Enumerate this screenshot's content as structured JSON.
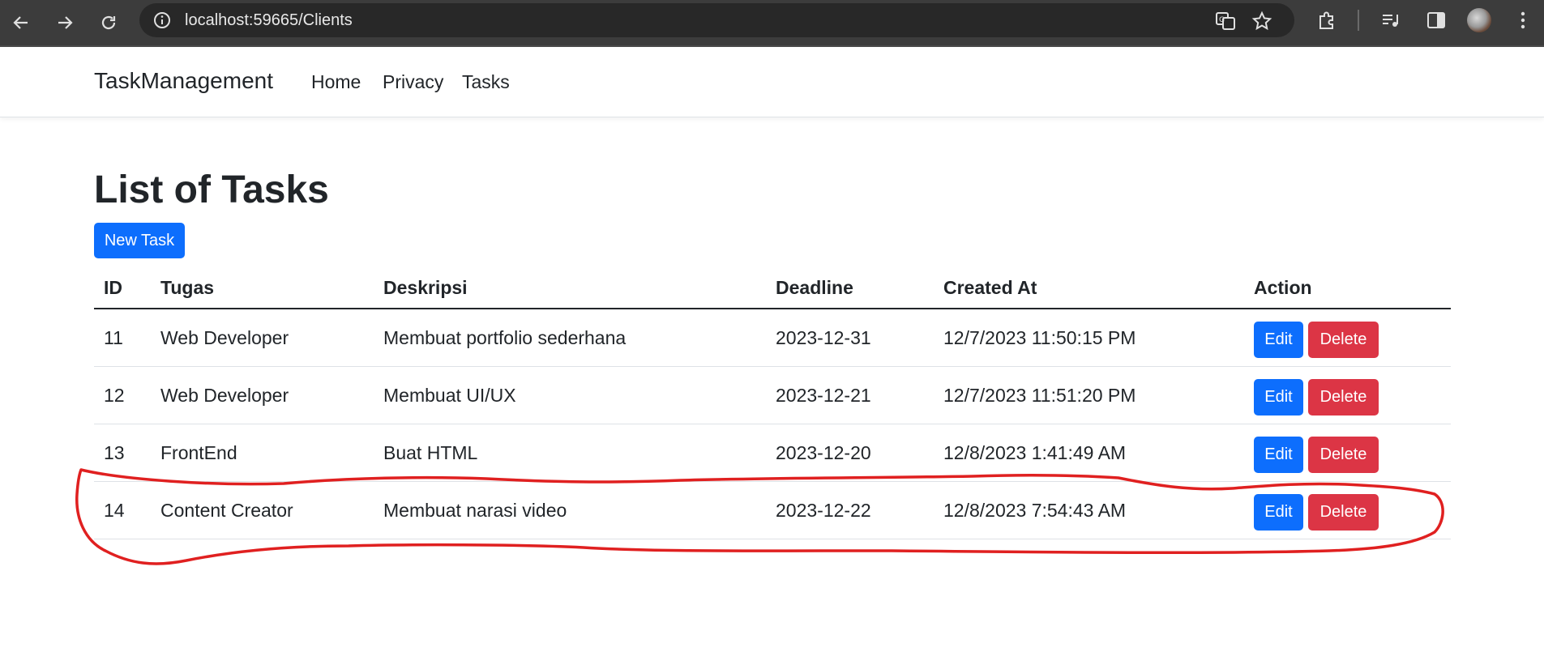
{
  "browser": {
    "url_host": "localhost:59665",
    "url_path": "/Clients"
  },
  "navbar": {
    "brand": "TaskManagement",
    "links": [
      "Home",
      "Privacy",
      "Tasks"
    ]
  },
  "main": {
    "title": "List of Tasks",
    "new_button": "New Task",
    "table": {
      "headers": [
        "ID",
        "Tugas",
        "Deskripsi",
        "Deadline",
        "Created At",
        "Action"
      ],
      "rows": [
        {
          "id": "11",
          "task": "Web Developer",
          "desc": "Membuat portfolio sederhana",
          "deadline": "2023-12-31",
          "created": "12/7/2023 11:50:15 PM"
        },
        {
          "id": "12",
          "task": "Web Developer",
          "desc": "Membuat UI/UX",
          "deadline": "2023-12-21",
          "created": "12/7/2023 11:51:20 PM"
        },
        {
          "id": "13",
          "task": "FrontEnd",
          "desc": "Buat HTML",
          "deadline": "2023-12-20",
          "created": "12/8/2023 1:41:49 AM"
        },
        {
          "id": "14",
          "task": "Content Creator",
          "desc": "Membuat narasi video",
          "deadline": "2023-12-22",
          "created": "12/8/2023 7:54:43 AM"
        }
      ],
      "edit_label": "Edit",
      "delete_label": "Delete"
    }
  },
  "colors": {
    "primary": "#0d6efd",
    "danger": "#dc3545",
    "annotation": "#e02020"
  }
}
